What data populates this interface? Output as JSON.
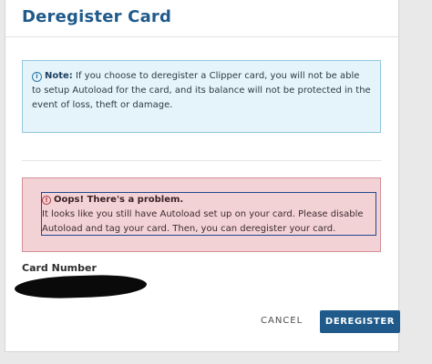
{
  "dialog": {
    "title": "Deregister Card"
  },
  "note": {
    "icon": "info-circle-icon",
    "label": "Note:",
    "text": "If you choose to deregister a Clipper card, you will not be able to setup Autoload for the card, and its balance will not be protected in the event of loss, theft or damage."
  },
  "error": {
    "icon": "error-circle-icon",
    "heading": "Oops! There's a problem.",
    "message": "It looks like you still have Autoload set up on your card. Please disable Autoload and tag your card. Then, you can deregister your card."
  },
  "card": {
    "label": "Card Number"
  },
  "actions": {
    "cancel_label": "CANCEL",
    "deregister_label": "DEREGISTER"
  },
  "colors": {
    "brand": "#1f5a8a",
    "note_bg": "#e5f3fa",
    "error_bg": "#f3d2d6"
  }
}
